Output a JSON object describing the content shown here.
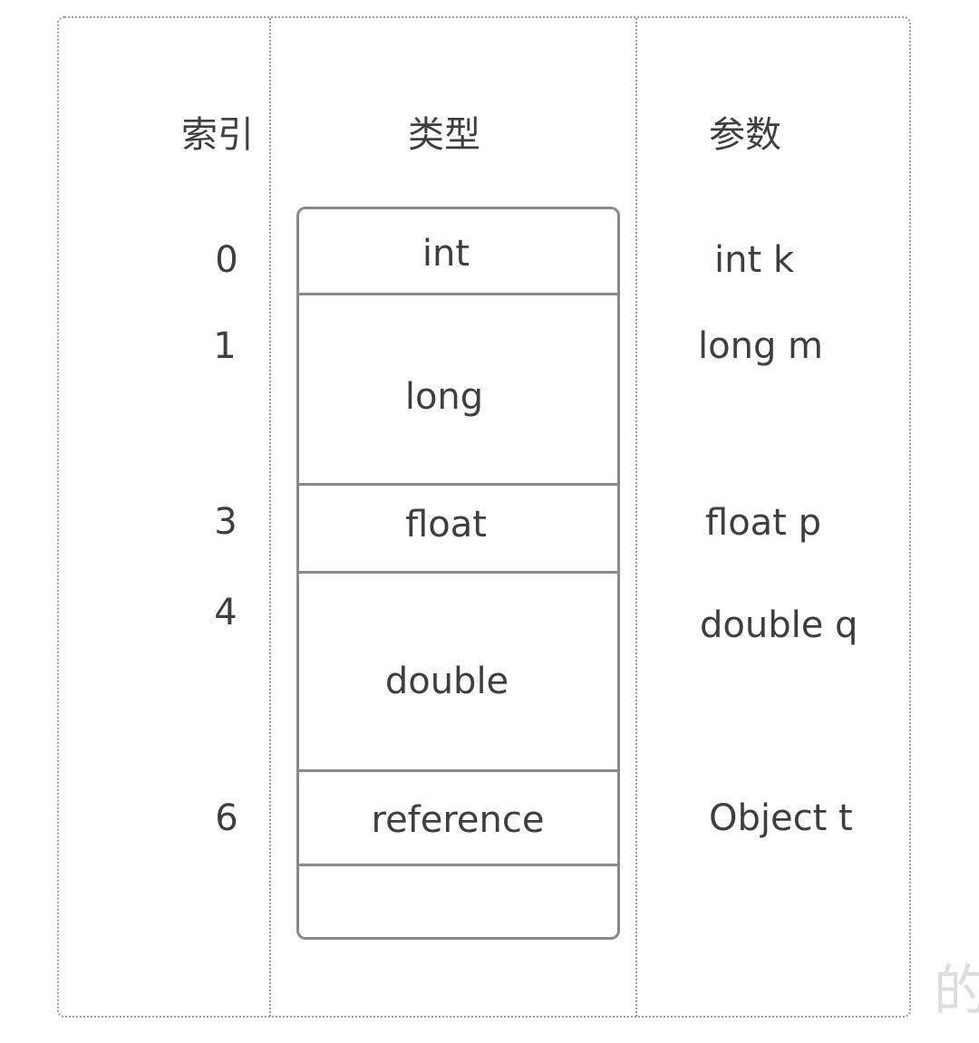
{
  "headers": {
    "index": "索引",
    "type": "类型",
    "params": "参数"
  },
  "slots": [
    {
      "index": "0",
      "type": "int",
      "param": "int k"
    },
    {
      "index": "1",
      "type": "long",
      "param": "long m"
    },
    {
      "index": "3",
      "type": "float",
      "param": "float p"
    },
    {
      "index": "4",
      "type": "double",
      "param": "double q"
    },
    {
      "index": "6",
      "type": "reference",
      "param": "Object t"
    },
    {
      "index": "",
      "type": "",
      "param": ""
    }
  ],
  "watermark": "的"
}
